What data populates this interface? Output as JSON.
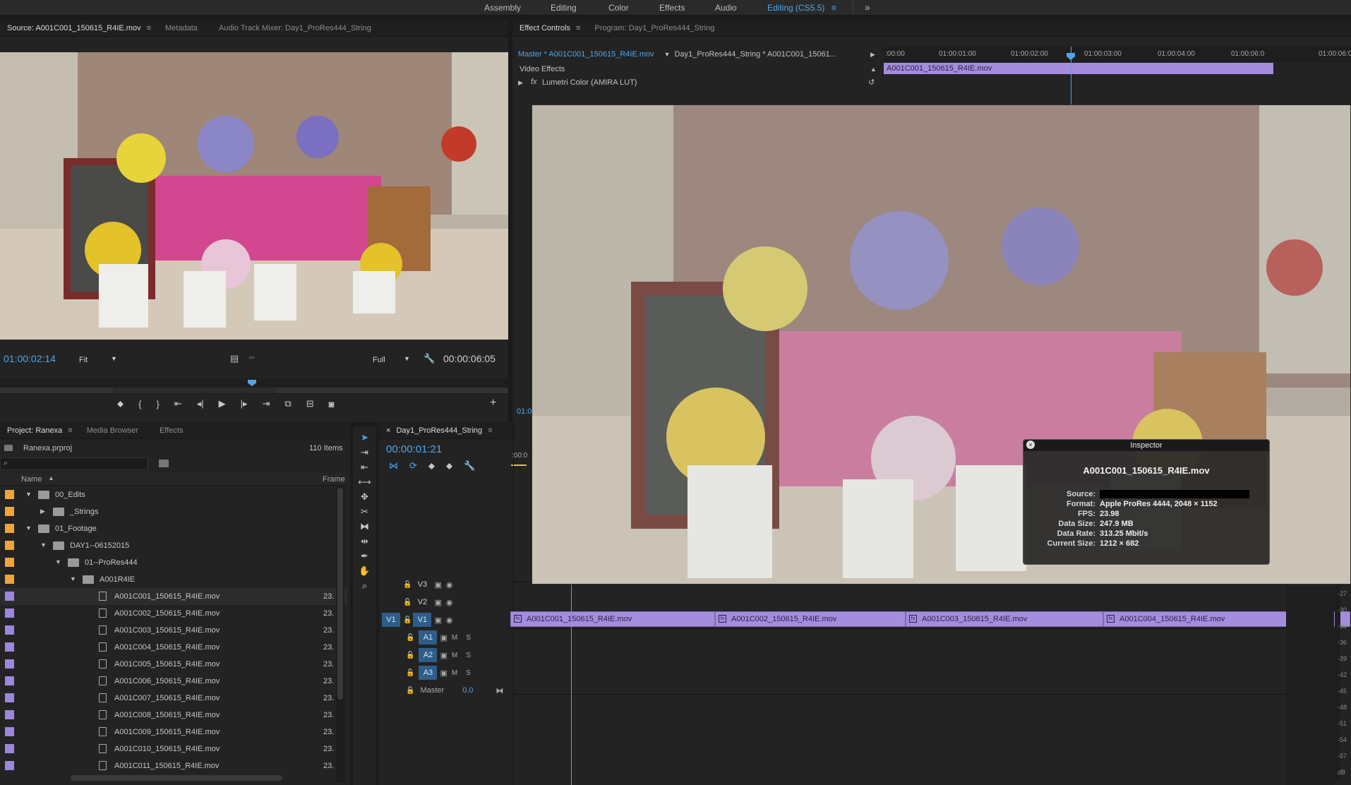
{
  "workspaces": {
    "items": [
      "Assembly",
      "Editing",
      "Color",
      "Effects",
      "Audio",
      "Editing (CS5.5)"
    ],
    "active": "Editing (CS5.5)",
    "more": "»"
  },
  "source_monitor": {
    "tabs": [
      "Source: A001C001_150615_R4IE.mov",
      "Metadata",
      "Audio Track Mixer: Day1_ProRes444_String"
    ],
    "timecode_in": "01:00:02:14",
    "fit": "Fit",
    "quality": "Full",
    "duration": "00:00:06:05"
  },
  "effect_controls": {
    "tabs": [
      "Effect Controls",
      "Program: Day1_ProRes444_String"
    ],
    "master_clip": "Master * A001C001_150615_R4IE.mov",
    "sequence_clip": "Day1_ProRes444_String * A001C001_15061...",
    "section": "Video Effects",
    "effect": "Lumetri Color (AMIRA LUT)",
    "fx": "fx",
    "ruler": [
      ":00:00",
      "01:00:01:00",
      "01:00:02:00",
      "01:00:03:00",
      "01:00:04:00",
      "01:00:06:0"
    ],
    "clip": "A001C001_150615_R4IE.mov",
    "timecode_stub": "01:0"
  },
  "project": {
    "tabs": [
      "Project: Ranexa",
      "Media Browser",
      "Effects"
    ],
    "file": "Ranexa.prproj",
    "count": "110 Items",
    "col_name": "Name",
    "col_frame": "Frame",
    "items": [
      {
        "name": "00_Edits",
        "depth": 0,
        "type": "folder",
        "open": true,
        "color": "#f0a43a"
      },
      {
        "name": "_Strings",
        "depth": 1,
        "type": "folder",
        "open": false,
        "color": "#f0a43a"
      },
      {
        "name": "01_Footage",
        "depth": 0,
        "type": "folder",
        "open": true,
        "color": "#f0a43a"
      },
      {
        "name": "DAY1--06152015",
        "depth": 1,
        "type": "folder",
        "open": true,
        "color": "#f0a43a"
      },
      {
        "name": "01--ProRes444",
        "depth": 2,
        "type": "folder",
        "open": true,
        "color": "#f0a43a"
      },
      {
        "name": "A001R4IE",
        "depth": 3,
        "type": "folder",
        "open": true,
        "color": "#f0a43a"
      },
      {
        "name": "A001C001_150615_R4IE.mov",
        "depth": 4,
        "type": "clip",
        "frame": "23.",
        "color": "#9d86de"
      },
      {
        "name": "A001C002_150615_R4IE.mov",
        "depth": 4,
        "type": "clip",
        "frame": "23.",
        "color": "#9d86de"
      },
      {
        "name": "A001C003_150615_R4IE.mov",
        "depth": 4,
        "type": "clip",
        "frame": "23.",
        "color": "#9d86de"
      },
      {
        "name": "A001C004_150615_R4IE.mov",
        "depth": 4,
        "type": "clip",
        "frame": "23.",
        "color": "#9d86de"
      },
      {
        "name": "A001C005_150615_R4IE.mov",
        "depth": 4,
        "type": "clip",
        "frame": "23.",
        "color": "#9d86de"
      },
      {
        "name": "A001C006_150615_R4IE.mov",
        "depth": 4,
        "type": "clip",
        "frame": "23.",
        "color": "#9d86de"
      },
      {
        "name": "A001C007_150615_R4IE.mov",
        "depth": 4,
        "type": "clip",
        "frame": "23.",
        "color": "#9d86de"
      },
      {
        "name": "A001C008_150615_R4IE.mov",
        "depth": 4,
        "type": "clip",
        "frame": "23.",
        "color": "#9d86de"
      },
      {
        "name": "A001C009_150615_R4IE.mov",
        "depth": 4,
        "type": "clip",
        "frame": "23.",
        "color": "#9d86de"
      },
      {
        "name": "A001C010_150615_R4IE.mov",
        "depth": 4,
        "type": "clip",
        "frame": "23.",
        "color": "#9d86de"
      },
      {
        "name": "A001C011_150615_R4IE.mov",
        "depth": 4,
        "type": "clip",
        "frame": "23.",
        "color": "#9d86de"
      }
    ]
  },
  "timeline": {
    "tab": "Day1_ProRes444_String",
    "close": "×",
    "timecode": "00:00:01:21",
    "ruler_start": ":00:0",
    "video_tracks": [
      "V3",
      "V2",
      "V1"
    ],
    "audio_tracks": [
      "A1",
      "A2",
      "A3"
    ],
    "source_patch": "V1",
    "master_label": "Master",
    "master_value": "0.0",
    "m": "M",
    "s": "S",
    "clips": [
      "A001C001_150615_R4IE.mov",
      "A001C002_150615_R4IE.mov",
      "A001C003_150615_R4IE.mov",
      "A001C004_150615_R4IE.mov"
    ],
    "meter_labels": [
      "-27",
      "-30",
      "-33",
      "-36",
      "-39",
      "-42",
      "-45",
      "-48",
      "-51",
      "-54",
      "-57",
      "dB"
    ]
  },
  "inspector": {
    "title": "Inspector",
    "filename": "A001C001_150615_R4IE.mov",
    "rows": [
      {
        "k": "Source:",
        "v": ""
      },
      {
        "k": "Format:",
        "v": "Apple ProRes 4444, 2048 × 1152"
      },
      {
        "k": "FPS:",
        "v": "23.98"
      },
      {
        "k": "Data Size:",
        "v": "247.9 MB"
      },
      {
        "k": "Data Rate:",
        "v": "313.25 Mbit/s"
      },
      {
        "k": "Current Size:",
        "v": "1212 × 682"
      }
    ]
  },
  "colors": {
    "accent": "#4ea6ea",
    "clip": "#a48ddc",
    "folder_label": "#f0a43a",
    "clip_label": "#9d86de"
  }
}
